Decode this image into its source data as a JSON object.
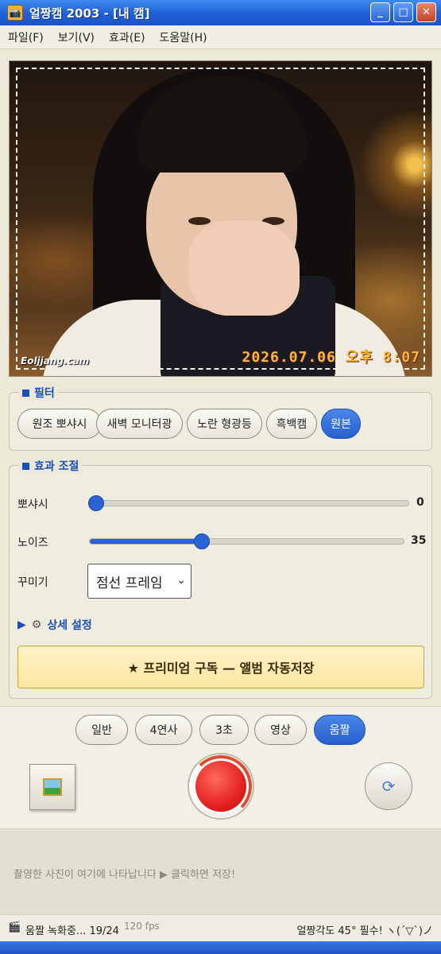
{
  "window": {
    "title": "얼짱캠 2003 - [내 캠]",
    "minimize_glyph": "_",
    "maximize_glyph": "□",
    "close_glyph": "✕",
    "app_icon": "camera-icon"
  },
  "menu": [
    "파일(F)",
    "보기(V)",
    "효과(E)",
    "도움말(H)"
  ],
  "photo": {
    "watermark": "Eoljjang.cam",
    "timestamp": "2026.07.06 오후 8:07"
  },
  "filters": {
    "legend": "필터",
    "items": [
      {
        "label": "원조 뽀샤시",
        "active": false
      },
      {
        "label": "새벽 모니터광",
        "active": false
      },
      {
        "label": "노란 형광등",
        "active": false
      },
      {
        "label": "흑백캠",
        "active": false
      },
      {
        "label": "원본",
        "active": true
      }
    ]
  },
  "effects": {
    "legend": "효과 조절",
    "blur_label": "뽀샤시",
    "blur_value": "0",
    "noise_label": "노이즈",
    "noise_value": "35",
    "decor_label": "꾸미기",
    "decor_selected": "점선 프레임",
    "details_label": "상세 설정",
    "premium_label": "★ 프리미엄 구독 — 앨범 자동저장"
  },
  "modes": [
    {
      "label": "일반",
      "active": false
    },
    {
      "label": "4연사",
      "active": false
    },
    {
      "label": "3초",
      "active": false
    },
    {
      "label": "영상",
      "active": false
    },
    {
      "label": "움짤",
      "active": true
    }
  ],
  "tray": {
    "hint": "촬영한 사진이 여기에 나타납니다 ▶ 클릭하면 저장!"
  },
  "status": {
    "recording": "움짤 녹화중... 19/24",
    "fps": "120 fps",
    "tip": "얼짱각도 45° 필수! ヽ(´▽`)ノ"
  },
  "colors": {
    "accent": "#2a63d5",
    "titlebar": "#1f5fd6",
    "shutter": "#e11d1d",
    "timestamp": "#ffb43b"
  }
}
